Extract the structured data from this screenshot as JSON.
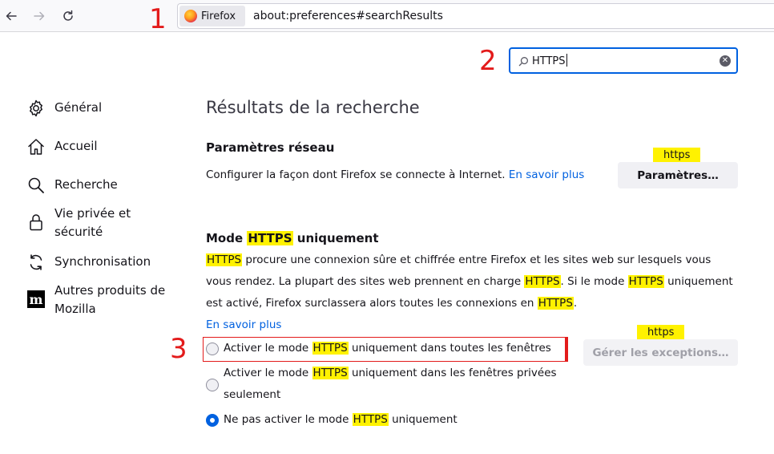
{
  "browser": {
    "identity_label": "Firefox",
    "url": "about:preferences#searchResults"
  },
  "annotations": [
    "1",
    "2",
    "3"
  ],
  "search": {
    "value": "HTTPS"
  },
  "sidebar": {
    "items": [
      {
        "label": "Général",
        "icon": "gear-icon"
      },
      {
        "label": "Accueil",
        "icon": "home-icon"
      },
      {
        "label": "Recherche",
        "icon": "search-icon"
      },
      {
        "label": "Vie privée et sécurité",
        "icon": "lock-icon"
      },
      {
        "label": "Synchronisation",
        "icon": "sync-icon"
      },
      {
        "label": "Autres produits de Mozilla",
        "icon": "mozilla-icon"
      }
    ]
  },
  "main": {
    "title": "Résultats de la recherche",
    "network": {
      "title": "Paramètres réseau",
      "description": "Configurer la façon dont Firefox se connecte à Internet.",
      "learn_more": "En savoir plus",
      "button_label": "Paramètres…",
      "tooltip": "https"
    },
    "https_mode": {
      "title_before": "Mode ",
      "title_mark": "HTTPS",
      "title_after": " uniquement",
      "para_line1_mark": "HTTPS",
      "para_line1_rest": " procure une connexion sûre et chiffrée entre Firefox et les sites web sur lesquels vous",
      "para_line2_a": "vous rendez. La plupart des sites web prennent en charge ",
      "para_line2_mark1": "HTTPS",
      "para_line2_b": ". Si le mode ",
      "para_line2_mark2": "HTTPS",
      "para_line2_c": " uniquement",
      "para_line3_a": "est activé, Firefox surclassera alors toutes les connexions en ",
      "para_line3_mark": "HTTPS",
      "para_line3_b": ".",
      "learn_more": "En savoir plus",
      "exceptions_button": "Gérer les exceptions…",
      "exceptions_tooltip": "https",
      "options": [
        {
          "before": "Activer le mode ",
          "mark": "HTTPS",
          "after": " uniquement dans toutes les fenêtres",
          "checked": false
        },
        {
          "before": "Activer le mode ",
          "mark": "HTTPS",
          "after": " uniquement dans les fenêtres privées",
          "line2": "seulement",
          "checked": false
        },
        {
          "before": "Ne pas activer le mode ",
          "mark": "HTTPS",
          "after": " uniquement",
          "checked": true
        }
      ]
    }
  },
  "colors": {
    "accent": "#0061e0",
    "highlight": "#fff200",
    "annotation": "#e31b1b"
  }
}
